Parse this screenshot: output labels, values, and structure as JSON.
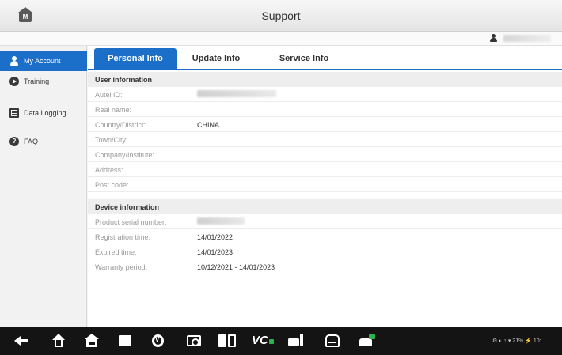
{
  "header": {
    "title": "Support"
  },
  "user": {
    "name_obscured": true
  },
  "sidebar": {
    "items": [
      {
        "label": "My Account",
        "icon": "user-icon",
        "active": true
      },
      {
        "label": "Training",
        "icon": "play-icon",
        "active": false
      },
      {
        "label": "Data Logging",
        "icon": "log-icon",
        "active": false
      },
      {
        "label": "FAQ",
        "icon": "faq-icon",
        "active": false
      }
    ]
  },
  "tabs": [
    {
      "label": "Personal Info",
      "active": true
    },
    {
      "label": "Update Info",
      "active": false
    },
    {
      "label": "Service Info",
      "active": false
    }
  ],
  "user_information": {
    "heading": "User information",
    "fields": [
      {
        "key": "Autel ID:",
        "value": ""
      },
      {
        "key": "Real name:",
        "value": ""
      },
      {
        "key": "Country/District:",
        "value": "CHINA"
      },
      {
        "key": "Town/City:",
        "value": ""
      },
      {
        "key": "Company/Institute:",
        "value": ""
      },
      {
        "key": "Address:",
        "value": ""
      },
      {
        "key": "Post code:",
        "value": ""
      }
    ]
  },
  "device_information": {
    "heading": "Device information",
    "fields": [
      {
        "key": "Product serial number:",
        "value": ""
      },
      {
        "key": "Registration time:",
        "value": "14/01/2022"
      },
      {
        "key": "Expired time:",
        "value": "14/01/2023"
      },
      {
        "key": "Warranty period:",
        "value": "10/12/2021 - 14/01/2023"
      }
    ]
  },
  "navbar": {
    "items": [
      "back-icon",
      "home-icon",
      "autel-home-icon",
      "recent-apps-icon",
      "vpn-shield-icon",
      "screenshot-camera-icon",
      "vci-manager-icon",
      "vc-icon",
      "car-fuel-icon",
      "car-icon",
      "car-green-icon"
    ],
    "vc_label": "VC",
    "status_text": "⚙ ◐ ↑ ▾ 21% ⚡ 10:"
  },
  "colors": {
    "accent": "#1b6fc8",
    "navbar": "#141414",
    "status_green": "#2db34a"
  }
}
